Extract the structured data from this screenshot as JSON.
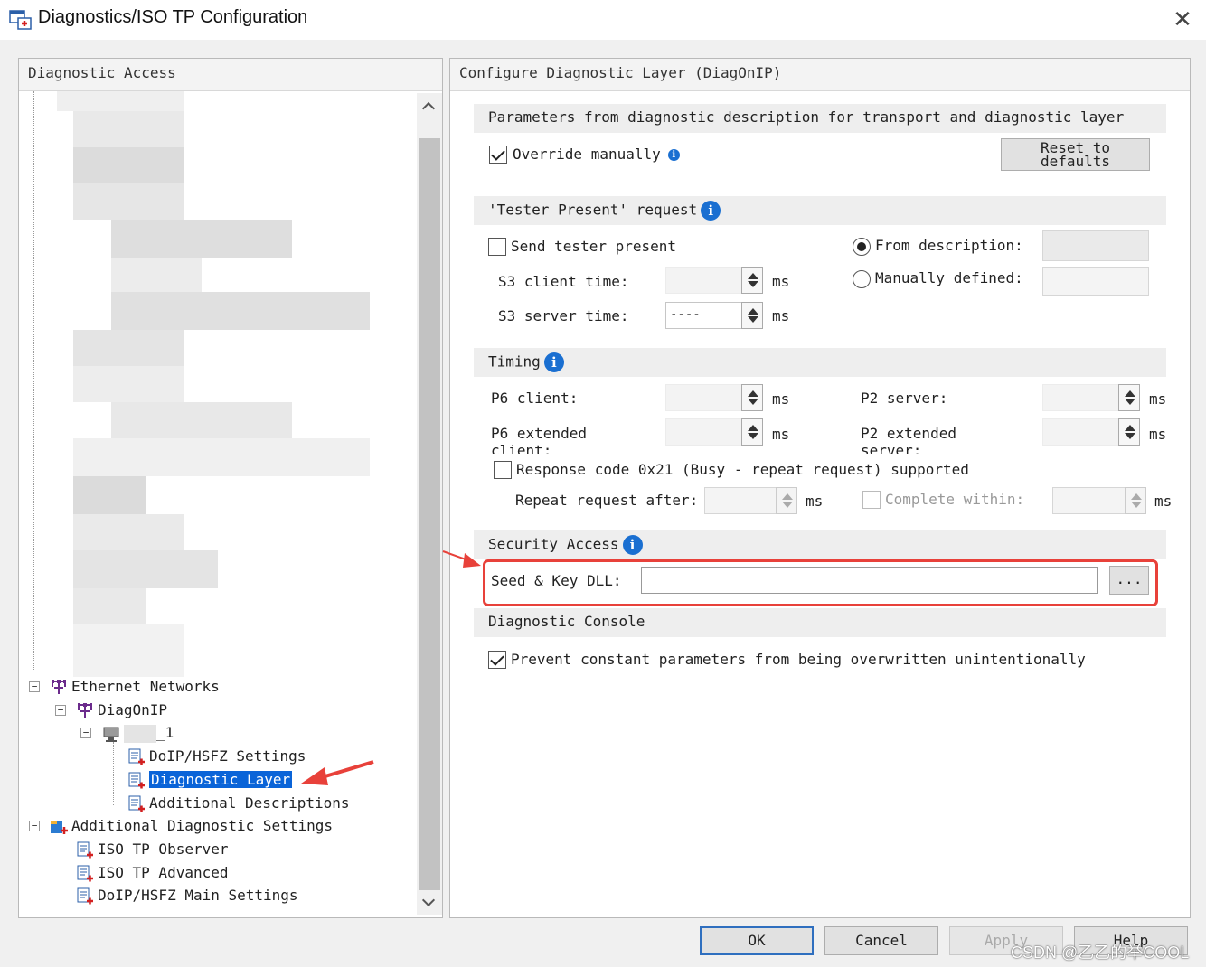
{
  "window": {
    "title": "Diagnostics/ISO TP Configuration",
    "close_glyph": "✕"
  },
  "left_panel": {
    "header": "Diagnostic Access",
    "tree": {
      "ethernet_networks": "Ethernet Networks",
      "diagonip": "DiagOnIP",
      "node_suffix": "_1",
      "doip_settings": "DoIP/HSFZ Settings",
      "diagnostic_layer": "Diagnostic Layer",
      "additional_descriptions": "Additional Descriptions",
      "additional_diag_settings": "Additional Diagnostic Settings",
      "iso_tp_observer": "ISO TP Observer",
      "iso_tp_advanced": "ISO TP Advanced",
      "doip_main_settings": "DoIP/HSFZ Main Settings"
    }
  },
  "right_panel": {
    "header": "Configure Diagnostic Layer (DiagOnIP)",
    "params": {
      "section_title": "Parameters from diagnostic description for transport and diagnostic layer",
      "override_label": "Override manually",
      "override_checked": true,
      "reset_button": "Reset to defaults"
    },
    "tester_present": {
      "section_title": "'Tester Present' request",
      "send_label": "Send tester present",
      "send_checked": false,
      "s3_client_label": "S3 client time:",
      "s3_server_label": "S3 server time:",
      "s3_server_value": "----",
      "unit": "ms",
      "from_description_label": "From description:",
      "manually_defined_label": "Manually defined:",
      "selected_mode": "From description"
    },
    "timing": {
      "section_title": "Timing",
      "p6_client_label": "P6 client:",
      "p6_extended_label": "P6 extended",
      "p6_extended_label_cont": "client:",
      "p2_server_label": "P2 server:",
      "p2_extended_label": "P2 extended",
      "p2_extended_label_cont": "server:",
      "unit": "ms",
      "response_label": "Response code 0x21 (Busy - repeat request) supported",
      "response_checked": false,
      "repeat_label": "Repeat request after:",
      "complete_label": "Complete within:"
    },
    "security": {
      "section_title": "Security Access",
      "seed_key_label": "Seed & Key DLL:",
      "seed_key_value": "",
      "browse_button": "..."
    },
    "console": {
      "section_title": "Diagnostic Console",
      "prevent_label": "Prevent constant parameters from being overwritten unintentionally",
      "prevent_checked": true
    }
  },
  "footer": {
    "ok": "OK",
    "cancel": "Cancel",
    "apply": "Apply",
    "help": "Help",
    "watermark": "CSDN @乙乙的举COOL"
  },
  "colors": {
    "accent": "#0a64d8",
    "annotation_red": "#e8413a",
    "info_blue": "#1a6fd1"
  }
}
